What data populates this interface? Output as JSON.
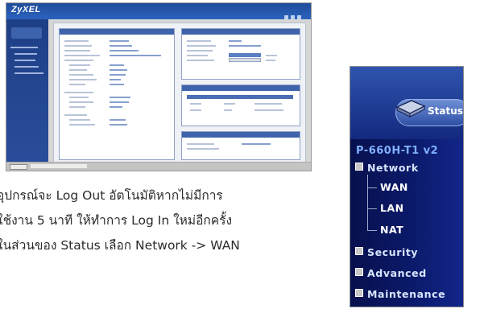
{
  "screenshot": {
    "logo_text": "ZyXEL"
  },
  "caption": {
    "line1": "อุปกรณ์จะ Log Out อัตโนมัติหากไม่มีการ",
    "line2": "ใช้งาน 5 นาที ให้ทำการ Log In ใหม่อีกครั้ง",
    "line3": "ในส่วนของ Status เลือก Network -> WAN"
  },
  "menu": {
    "status_label": "Status",
    "model": "P-660H-T1 v2",
    "items": [
      {
        "label": "Network",
        "icon": "minus-box-icon",
        "expanded": true
      },
      {
        "label": "Security",
        "icon": "plus-box-icon",
        "expanded": false
      },
      {
        "label": "Advanced",
        "icon": "plus-box-icon",
        "expanded": false
      },
      {
        "label": "Maintenance",
        "icon": "plus-box-icon",
        "expanded": false
      }
    ],
    "network_children": [
      "WAN",
      "LAN",
      "NAT"
    ]
  },
  "colors": {
    "menu_bg": "#0b1a6a",
    "menu_model": "#7fb0ff",
    "zyxel_blue": "#2b63bd"
  }
}
